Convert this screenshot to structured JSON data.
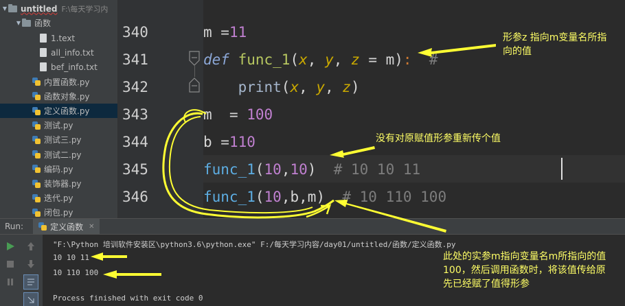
{
  "project": {
    "root_name": "untitled",
    "root_path": "F:\\每天学习内",
    "folder_name": "函数",
    "files": [
      {
        "name": "1.text",
        "type": "text"
      },
      {
        "name": "all_info.txt",
        "type": "text"
      },
      {
        "name": "bef_info.txt",
        "type": "text"
      },
      {
        "name": "内置函数.py",
        "type": "python"
      },
      {
        "name": "函数对象.py",
        "type": "python"
      },
      {
        "name": "定义函数.py",
        "type": "python",
        "selected": true
      },
      {
        "name": "测试.py",
        "type": "python"
      },
      {
        "name": "测试三.py",
        "type": "python"
      },
      {
        "name": "测试二.py",
        "type": "python"
      },
      {
        "name": "编码.py",
        "type": "python"
      },
      {
        "name": "装饰器.py",
        "type": "python"
      },
      {
        "name": "迭代.py",
        "type": "python"
      },
      {
        "name": "闭包.py",
        "type": "python"
      }
    ]
  },
  "editor": {
    "line_numbers": [
      "340",
      "341",
      "342",
      "343",
      "344",
      "345",
      "346"
    ],
    "current_line": "345",
    "lines": {
      "l340": {
        "a": "m ",
        "b": "=",
        "c": "11"
      },
      "l341": {
        "kw": "def",
        "fn": "func_1",
        "p1": "(",
        "x": "x",
        "c1": ", ",
        "y": "y",
        "c2": ", ",
        "z": "z",
        "eq": " = ",
        "m": "m",
        "p2": ")",
        "colon": ":",
        "comment": "  #"
      },
      "l342": {
        "indent": "    ",
        "fn": "print",
        "p1": "(",
        "x": "x",
        "c1": ", ",
        "y": "y",
        "c2": ", ",
        "z": "z",
        "p2": ")"
      },
      "l343": {
        "a": "m  ",
        "b": "= ",
        "c": "100"
      },
      "l344": {
        "a": "b ",
        "b": "=",
        "c": "110"
      },
      "l345": {
        "fn": "func_1",
        "p1": "(",
        "n1": "10",
        "c": ",",
        "n2": "10",
        "p2": ")",
        "comment": "  # 10 10 11"
      },
      "l346": {
        "fn": "func_1",
        "p1": "(",
        "n1": "10",
        "c1": ",",
        "b": "b",
        "c2": ",",
        "m": "m",
        "p2": ")",
        "comment": "  # 10 110 100"
      }
    }
  },
  "annotations": {
    "a1_line1": "形参z 指向m变量名所指",
    "a1_line2": "向的值",
    "a2": "没有对原赋值形参重新传个值",
    "a3_line1": "此处的实参m指向变量名m所指向的值",
    "a3_line2": "100，然后调用函数时，将该值传给原",
    "a3_line3": "先已经赋了值得形参"
  },
  "run_panel": {
    "label": "Run:",
    "tab_name": "定义函数",
    "console_lines": [
      "\"F:\\Python 培训软件安装区\\python3.6\\python.exe\" F:/每天学习内容/day01/untitled/函数/定义函数.py",
      "10 10 11",
      "10 110 100",
      "",
      "Process finished with exit code 0"
    ]
  },
  "colors": {
    "annotation": "#ffff66",
    "background": "#2b2b2b",
    "panel": "#3c3f41"
  }
}
